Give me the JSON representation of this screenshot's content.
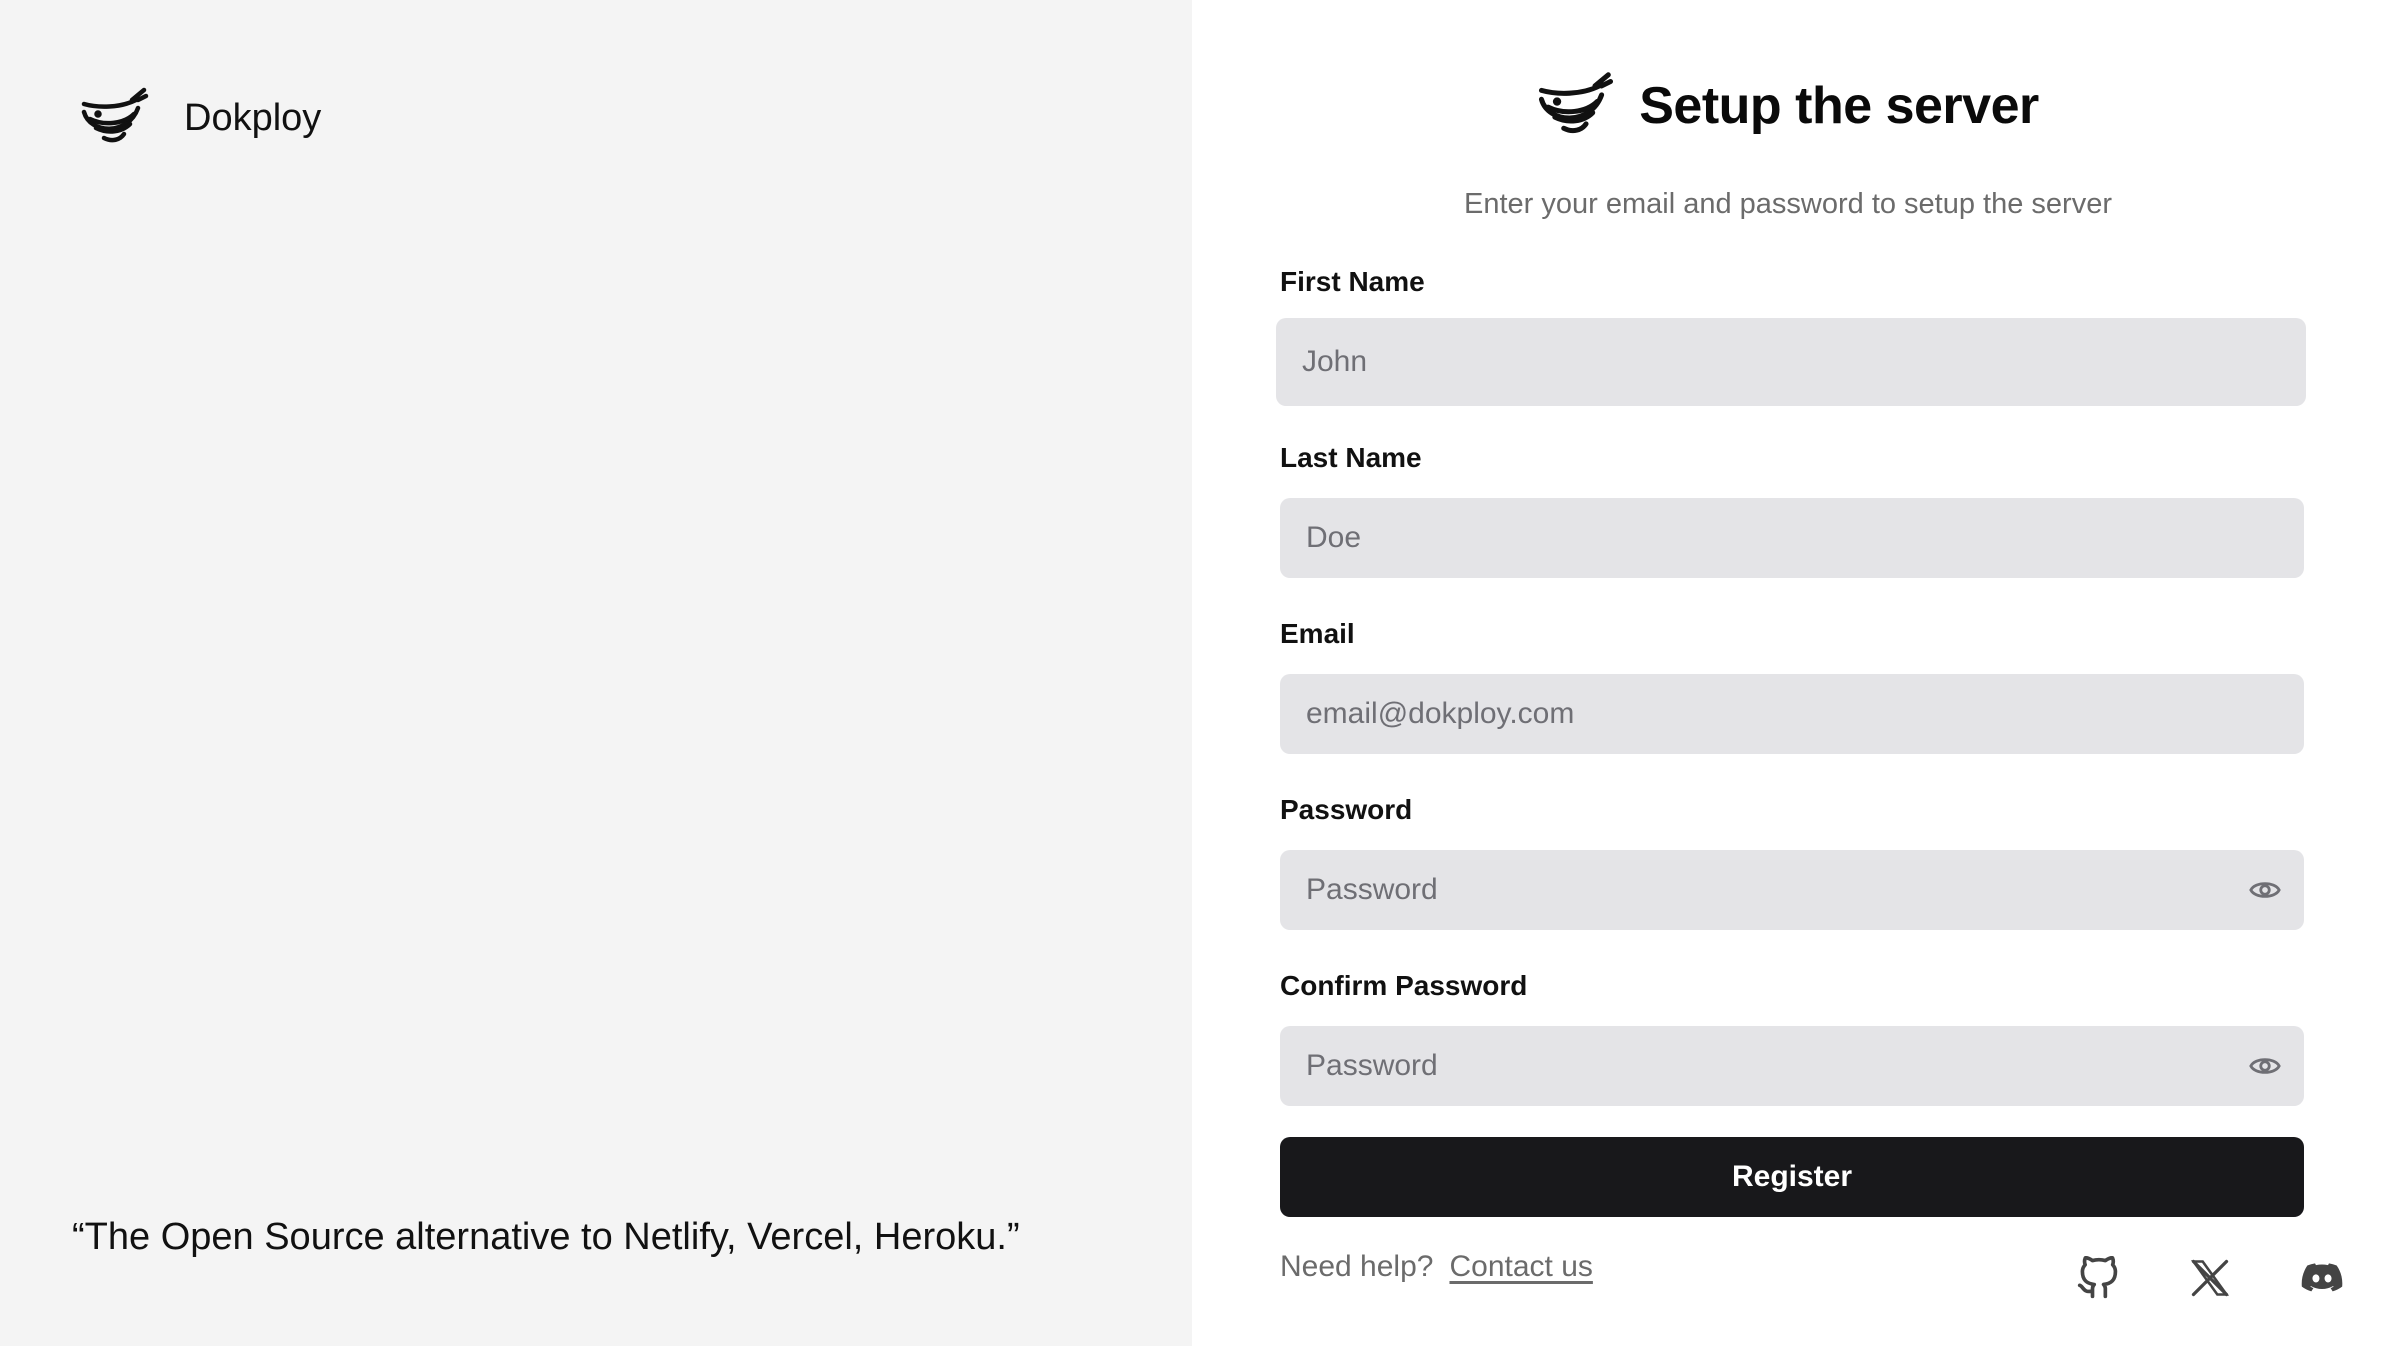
{
  "brand": {
    "name": "Dokploy"
  },
  "quote": "“The Open Source alternative to Netlify, Vercel, Heroku.”",
  "header": {
    "title": "Setup the server",
    "subtitle": "Enter your email and password to setup the server"
  },
  "form": {
    "first_name": {
      "label": "First Name",
      "placeholder": "John",
      "value": ""
    },
    "last_name": {
      "label": "Last Name",
      "placeholder": "Doe",
      "value": ""
    },
    "email": {
      "label": "Email",
      "placeholder": "email@dokploy.com",
      "value": ""
    },
    "password": {
      "label": "Password",
      "placeholder": "Password",
      "value": ""
    },
    "confirm_password": {
      "label": "Confirm Password",
      "placeholder": "Password",
      "value": ""
    },
    "submit_label": "Register"
  },
  "footer": {
    "help_text": "Need help?",
    "contact_label": "Contact us",
    "social_icons": [
      "github-icon",
      "x-icon",
      "discord-icon"
    ]
  },
  "colors": {
    "left_panel_bg": "#f4f4f4",
    "input_bg": "#e4e4e7",
    "button_bg": "#18181b",
    "muted_text": "#6b6b6b"
  }
}
